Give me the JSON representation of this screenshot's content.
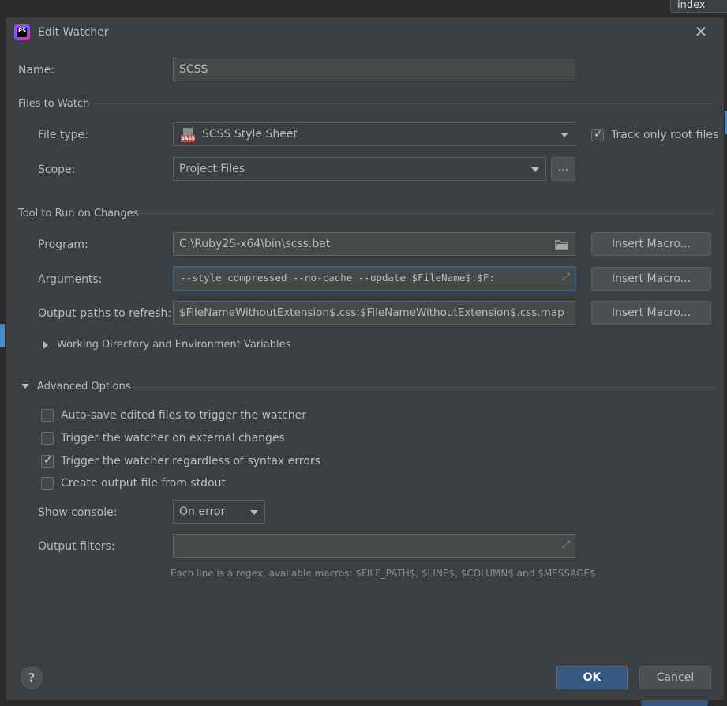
{
  "background": {
    "tab_label": "index"
  },
  "dialog": {
    "title": "Edit Watcher",
    "name_label": "Name:",
    "name_value": "SCSS",
    "files_to_watch": {
      "section_title": "Files to Watch",
      "file_type_label": "File type:",
      "file_type_value": "SCSS Style Sheet",
      "file_type_icon": "sass-icon",
      "track_root_label": "Track only root files",
      "track_root_checked": true,
      "scope_label": "Scope:",
      "scope_value": "Project Files",
      "scope_more_label": "..."
    },
    "tool": {
      "section_title": "Tool to Run on Changes",
      "program_label": "Program:",
      "program_value": "C:\\Ruby25-x64\\bin\\scss.bat",
      "arguments_label": "Arguments:",
      "arguments_value": "--style compressed --no-cache --update $FileName$:$F:",
      "output_paths_label": "Output paths to refresh:",
      "output_paths_value": "$FileNameWithoutExtension$.css:$FileNameWithoutExtension$.css.map",
      "insert_macro_label": "Insert Macro...",
      "working_dir_label": "Working Directory and Environment Variables"
    },
    "advanced": {
      "section_title": "Advanced Options",
      "options": [
        {
          "label": "Auto-save edited files to trigger the watcher",
          "checked": false
        },
        {
          "label": "Trigger the watcher on external changes",
          "checked": false
        },
        {
          "label": "Trigger the watcher regardless of syntax errors",
          "checked": true
        },
        {
          "label": "Create output file from stdout",
          "checked": false
        }
      ],
      "show_console_label": "Show console:",
      "show_console_value": "On error",
      "output_filters_label": "Output filters:",
      "output_filters_value": "",
      "hint": "Each line is a regex, available macros: $FILE_PATH$, $LINE$, $COLUMN$ and $MESSAGE$"
    },
    "help_label": "?",
    "ok_label": "OK",
    "cancel_label": "Cancel"
  },
  "colors": {
    "dialog_bg": "#3c3f41",
    "field_bg": "#45494a",
    "primary_button": "#365880",
    "focus_border": "#3d6185"
  }
}
